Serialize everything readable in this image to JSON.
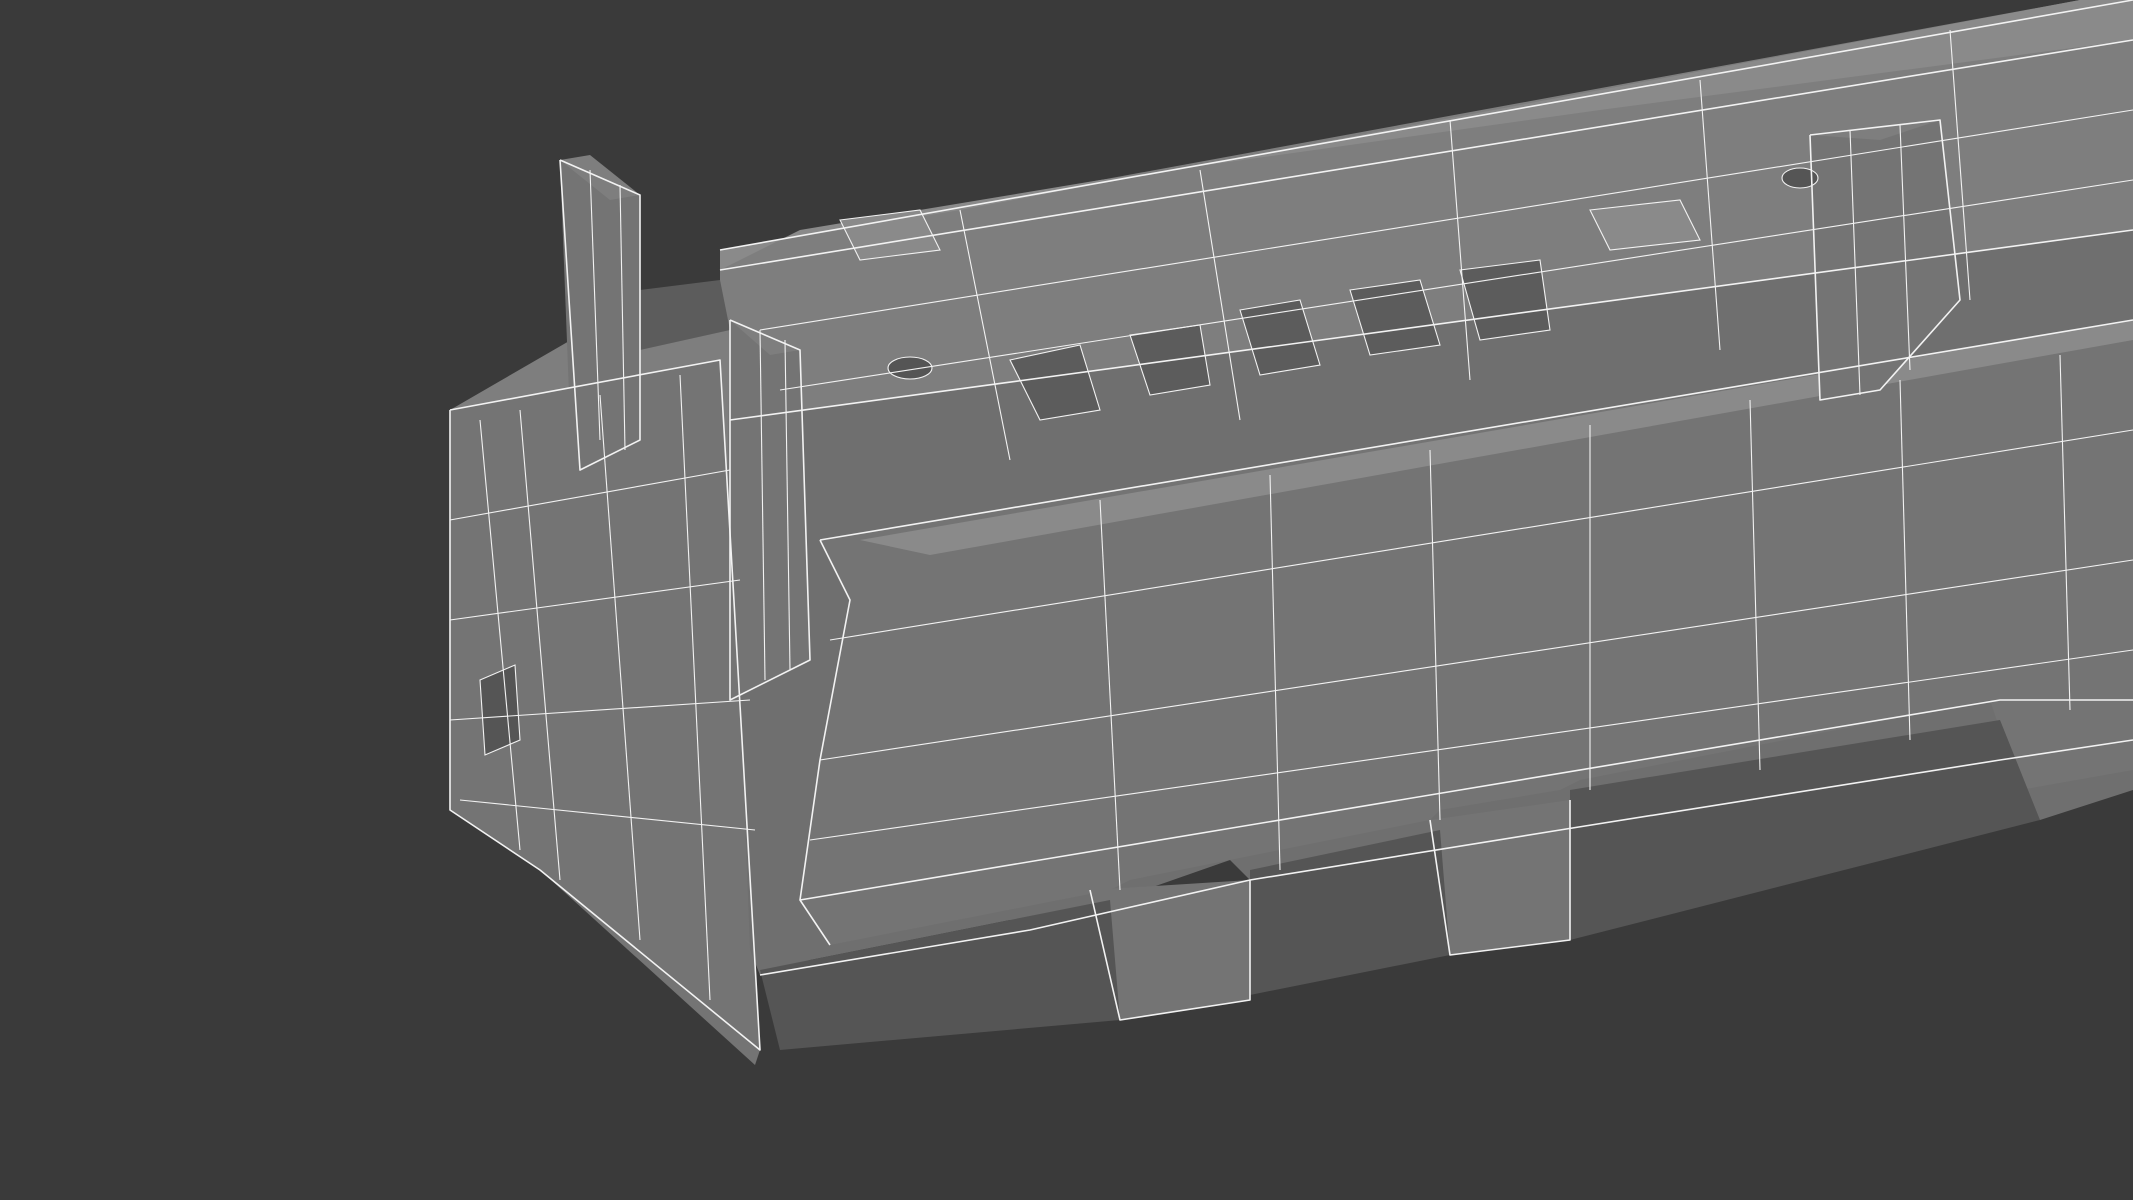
{
  "scene": {
    "background_color": "#3a3a3a",
    "model_fill_color": "#767676",
    "wireframe_color": "#f2f2f2",
    "subject": "wireframe-connector-model"
  }
}
